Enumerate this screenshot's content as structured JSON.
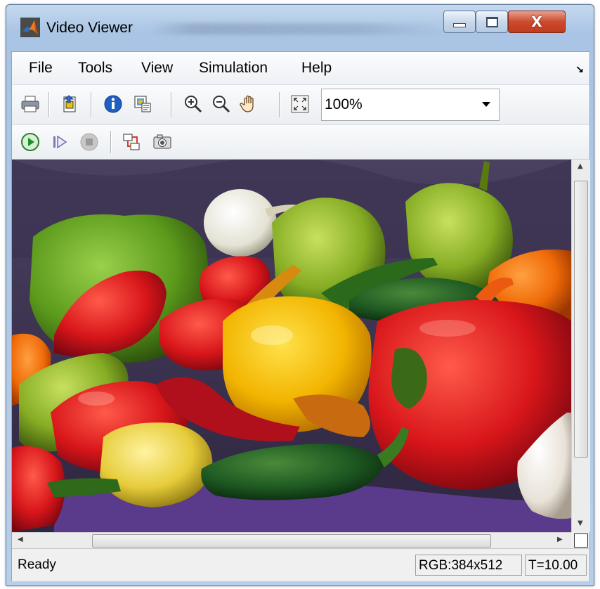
{
  "window": {
    "title": "Video Viewer",
    "controls": {
      "minimize": "minimize",
      "maximize": "maximize",
      "close": "X"
    }
  },
  "menu": {
    "items": [
      "File",
      "Tools",
      "View",
      "Simulation",
      "Help"
    ]
  },
  "toolbar": {
    "tools": [
      "print-icon",
      "export-icon",
      "info-icon",
      "properties-icon",
      "zoom-in-icon",
      "zoom-out-icon",
      "pan-icon",
      "fit-to-view-icon"
    ],
    "zoom_value": "100%"
  },
  "playback": {
    "tools": [
      "play-icon",
      "step-forward-icon",
      "stop-icon",
      "highlight-signal-icon",
      "snapshot-icon"
    ]
  },
  "status": {
    "text": "Ready",
    "image_info": "RGB:384x512",
    "time": "T=10.00"
  },
  "colors": {
    "title_bar": "#b8cfe9",
    "close_button": "#c84a2e",
    "background_cloth": "#3e3552"
  }
}
